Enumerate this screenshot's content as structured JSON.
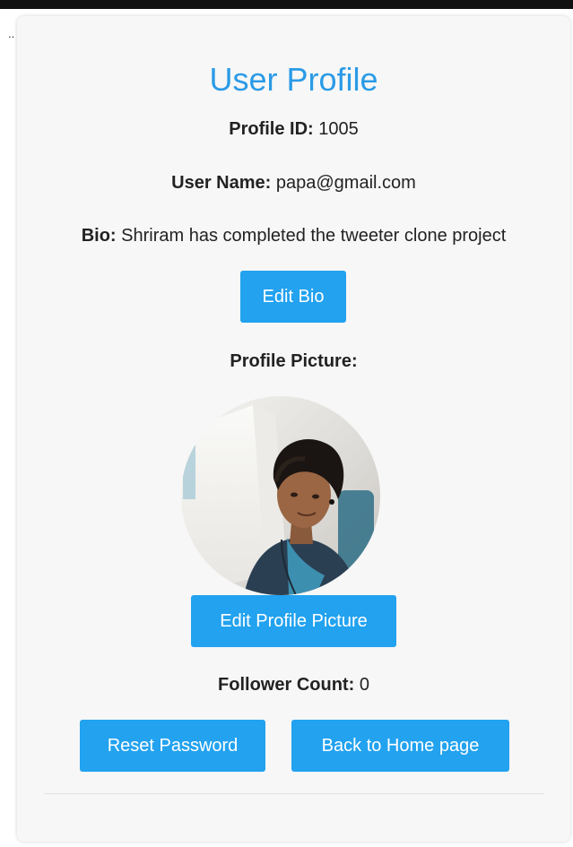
{
  "page": {
    "dots": ".."
  },
  "profile": {
    "title": "User Profile",
    "profile_id_label": "Profile ID:",
    "profile_id_value": "1005",
    "user_name_label": "User Name:",
    "user_name_value": "papa@gmail.com",
    "bio_label": "Bio:",
    "bio_value": "Shriram has completed the tweeter clone project",
    "edit_bio_button": "Edit Bio",
    "picture_label": "Profile Picture:",
    "edit_picture_button": "Edit Profile Picture",
    "follower_count_label": "Follower Count:",
    "follower_count_value": "0",
    "reset_password_button": "Reset Password",
    "home_button": "Back to Home page"
  },
  "colors": {
    "accent": "#22a2ef",
    "title": "#2a9be6",
    "card_background": "#f7f7f7"
  }
}
